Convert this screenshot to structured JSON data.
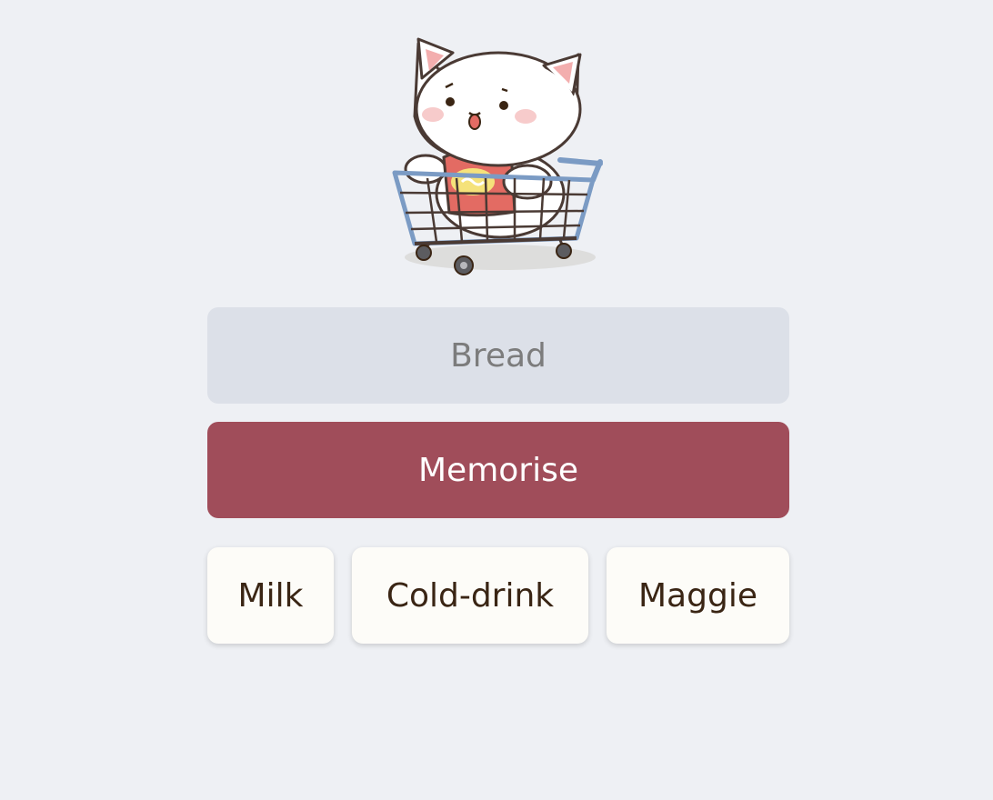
{
  "mascot": {
    "icon": "cat-in-shopping-cart-icon"
  },
  "input": {
    "placeholder": "Bread",
    "value": ""
  },
  "memorise_button": {
    "label": "Memorise",
    "color": "#a04d5a"
  },
  "items": [
    {
      "label": "Milk"
    },
    {
      "label": "Cold-drink"
    },
    {
      "label": "Maggie"
    }
  ],
  "colors": {
    "background": "#eef0f4",
    "input_background": "#dce0e8",
    "chip_background": "#fdfcf8",
    "chip_text": "#3a2514"
  }
}
